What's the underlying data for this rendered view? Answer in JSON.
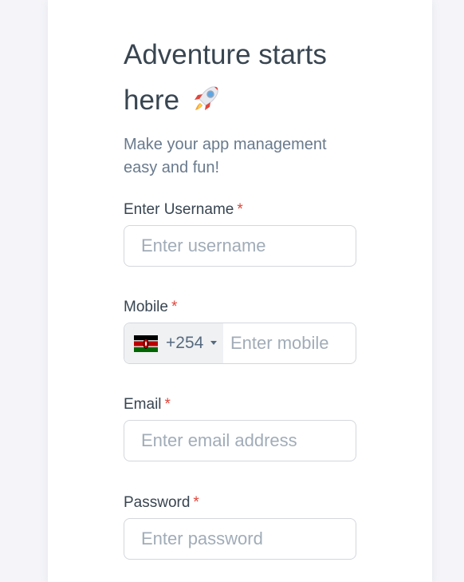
{
  "header": {
    "title": "Adventure starts here",
    "subtitle": "Make your app management easy and fun!"
  },
  "fields": {
    "username": {
      "label": "Enter Username",
      "required_mark": "*",
      "placeholder": "Enter username",
      "value": ""
    },
    "mobile": {
      "label": "Mobile",
      "required_mark": "*",
      "country_code": "+254",
      "country": "Kenya",
      "placeholder": "Enter mobile",
      "value": ""
    },
    "email": {
      "label": "Email",
      "required_mark": "*",
      "placeholder": "Enter email address",
      "value": ""
    },
    "password": {
      "label": "Password",
      "required_mark": "*",
      "placeholder": "Enter password",
      "value": ""
    }
  },
  "icons": {
    "title_emoji": "rocket-icon",
    "flag": "kenya-flag-icon",
    "dropdown": "chevron-down-icon"
  },
  "colors": {
    "required": "#e0463c",
    "text": "#384551",
    "placeholder": "#a1acb8",
    "border": "#d3d7dc"
  }
}
